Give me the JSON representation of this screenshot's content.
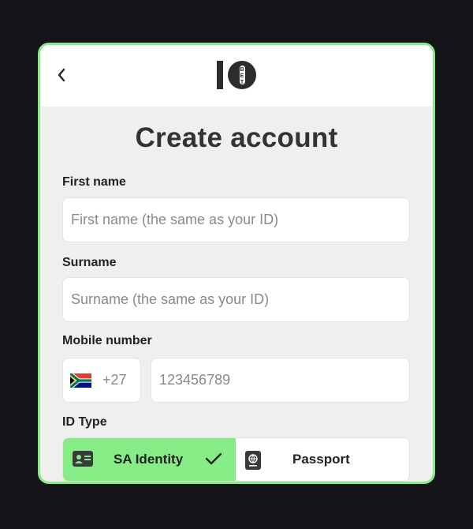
{
  "header": {
    "logo_text": "10BET"
  },
  "page": {
    "title": "Create account"
  },
  "form": {
    "first_name": {
      "label": "First name",
      "placeholder": "First name (the same as your ID)"
    },
    "surname": {
      "label": "Surname",
      "placeholder": "Surname (the same as your ID)"
    },
    "mobile": {
      "label": "Mobile number",
      "country_code": "+27",
      "placeholder": "123456789"
    },
    "id_type": {
      "label": "ID Type",
      "options": [
        {
          "label": "SA Identity",
          "icon": "id-card-icon",
          "selected": true
        },
        {
          "label": "Passport",
          "icon": "passport-icon",
          "selected": false
        }
      ]
    }
  },
  "colors": {
    "accent": "#86ec86",
    "background": "#141419",
    "panel": "#efefef"
  }
}
